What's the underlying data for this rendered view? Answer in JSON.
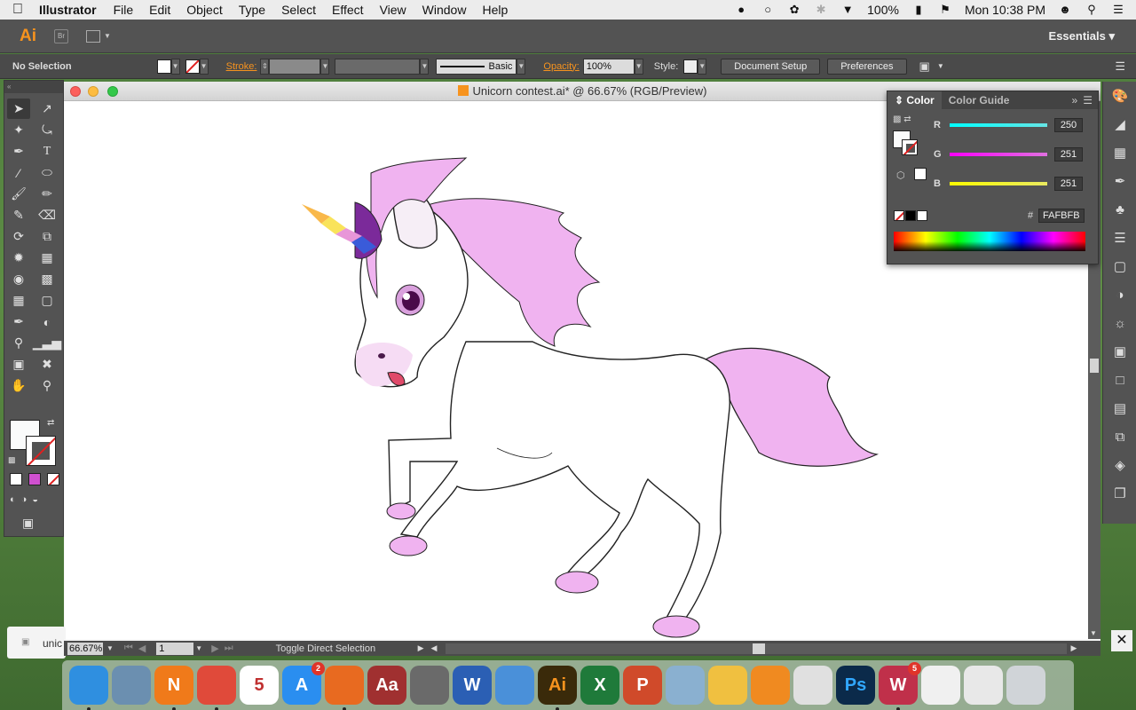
{
  "menubar": {
    "app_name": "Illustrator",
    "menus": [
      "File",
      "Edit",
      "Object",
      "Type",
      "Select",
      "Effect",
      "View",
      "Window",
      "Help"
    ],
    "battery": "100%",
    "clock": "Mon 10:38 PM"
  },
  "appbar": {
    "logo": "Ai",
    "bridge": "Br",
    "workspace": "Essentials"
  },
  "controlbar": {
    "selection": "No Selection",
    "stroke_label": "Stroke:",
    "brush": "Basic",
    "opacity_label": "Opacity:",
    "opacity_value": "100%",
    "style_label": "Style:",
    "document_setup": "Document Setup",
    "preferences": "Preferences"
  },
  "document": {
    "title": "Unicorn contest.ai* @ 66.67% (RGB/Preview)",
    "zoom": "66.67%",
    "page": "1",
    "status": "Toggle Direct Selection",
    "finder_partial": "unic"
  },
  "color_panel": {
    "tabs": [
      "Color",
      "Color Guide"
    ],
    "channels": [
      {
        "name": "R",
        "value": "250",
        "track": "#5fd9d9"
      },
      {
        "name": "G",
        "value": "251",
        "track": "#d94fd9"
      },
      {
        "name": "B",
        "value": "251",
        "track": "#e6e64a"
      }
    ],
    "hex_label": "#",
    "hex_value": "FAFBFB"
  },
  "colors": {
    "mane": "#f0b3f0",
    "horn_gold": "#f9b84a",
    "horn_blue": "#3a5bd9",
    "accent": "#f7931e"
  },
  "tools": [
    "selection-tool",
    "direct-selection-tool",
    "magic-wand-tool",
    "lasso-tool",
    "pen-tool",
    "type-tool",
    "line-tool",
    "ellipse-tool",
    "paintbrush-tool",
    "pencil-tool",
    "shaper-tool",
    "eraser-tool",
    "rotate-tool",
    "scale-tool",
    "warp-tool",
    "free-transform-tool",
    "shape-builder-tool",
    "perspective-grid-tool",
    "mesh-tool",
    "gradient-tool",
    "eyedropper-tool",
    "blend-tool",
    "symbol-sprayer-tool",
    "column-graph-tool",
    "artboard-tool",
    "slice-tool",
    "hand-tool",
    "zoom-tool"
  ],
  "dock": {
    "apps": [
      {
        "name": "finder",
        "letter": "",
        "color": "#2f8fe0"
      },
      {
        "name": "preview",
        "letter": "",
        "color": "#6b8fb0"
      },
      {
        "name": "nimble",
        "letter": "N",
        "color": "#f07a1a"
      },
      {
        "name": "chrome",
        "letter": "",
        "color": "#e04a3a"
      },
      {
        "name": "calendar",
        "letter": "5",
        "color": "#ffffff"
      },
      {
        "name": "app-store",
        "letter": "A",
        "color": "#2a8ef0",
        "badge": "2"
      },
      {
        "name": "firefox",
        "letter": "",
        "color": "#e86a20"
      },
      {
        "name": "dictionary",
        "letter": "Aa",
        "color": "#a03030"
      },
      {
        "name": "system-preferences",
        "letter": "",
        "color": "#6a6a6a"
      },
      {
        "name": "word",
        "letter": "W",
        "color": "#2b5fb4"
      },
      {
        "name": "mail-bird",
        "letter": "",
        "color": "#4a90d9"
      },
      {
        "name": "illustrator",
        "letter": "Ai",
        "color": "#3a2a0a"
      },
      {
        "name": "excel",
        "letter": "X",
        "color": "#1f7a3a"
      },
      {
        "name": "powerpoint",
        "letter": "P",
        "color": "#d04a2a"
      },
      {
        "name": "photo-viewer",
        "letter": "",
        "color": "#8ab0d0"
      },
      {
        "name": "photos",
        "letter": "",
        "color": "#f0c040"
      },
      {
        "name": "ibooks",
        "letter": "",
        "color": "#f08a20"
      },
      {
        "name": "acrobat",
        "letter": "",
        "color": "#e0e0e0"
      },
      {
        "name": "photoshop",
        "letter": "Ps",
        "color": "#0b2a4a"
      },
      {
        "name": "wps",
        "letter": "W",
        "color": "#c0304a",
        "badge": "5"
      },
      {
        "name": "document",
        "letter": "",
        "color": "#f0f0f0"
      },
      {
        "name": "document-2",
        "letter": "",
        "color": "#e8e8e8"
      },
      {
        "name": "trash",
        "letter": "",
        "color": "#d0d4d8"
      }
    ]
  }
}
